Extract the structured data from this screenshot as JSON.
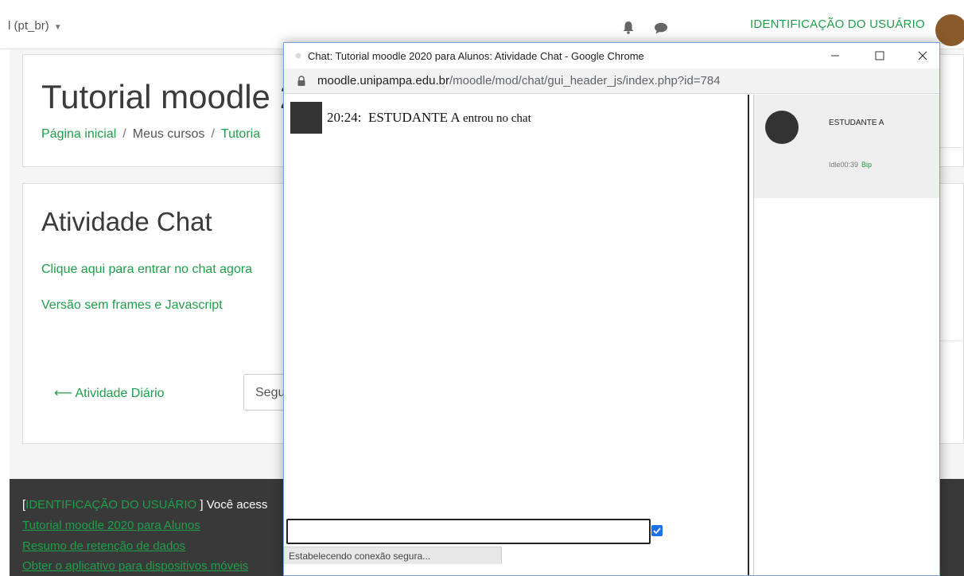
{
  "topbar": {
    "language": "l (pt_br)",
    "user_name": "IDENTIFICAÇÃO DO USUÁRIO"
  },
  "course": {
    "title": "Tutorial moodle 2",
    "breadcrumb": [
      "Página inicial",
      "Meus cursos",
      "Tutoria"
    ]
  },
  "activity": {
    "title": "Atividade Chat",
    "enter_link": "Clique aqui para entrar no chat agora",
    "noframes_link": "Versão sem frames e Javascript",
    "prev_activity": "Atividade Diário",
    "jump_select": "Segu"
  },
  "footer": {
    "bracket_open": "[",
    "user_id": "IDENTIFICAÇÃO DO USUÁRIO",
    "access_text": "] Você acess",
    "course_link": "Tutorial moodle 2020 para Alunos",
    "retention_link": "Resumo de retenção de dados",
    "app_link": "Obter o aplicativo para dispositivos móveis"
  },
  "popup": {
    "window_title": "Chat: Tutorial moodle 2020 para Alunos: Atividade Chat - Google Chrome",
    "url_host": "moodle.unipampa.edu.br",
    "url_path": "/moodle/mod/chat/gui_header_js/index.php?id=784",
    "message": {
      "time": "20:24:",
      "user": "ESTUDANTE A",
      "event": "entrou no chat"
    },
    "user_list": {
      "name": "ESTUDANTE A",
      "idle": "Idle00:39",
      "beep": "Bip"
    },
    "input_value": "",
    "status": "Estabelecendo conexão segura..."
  },
  "colors": {
    "brand_green": "#1e9f4a",
    "footer_bg": "#393939",
    "avatar_brown": "#8b5a2b"
  }
}
